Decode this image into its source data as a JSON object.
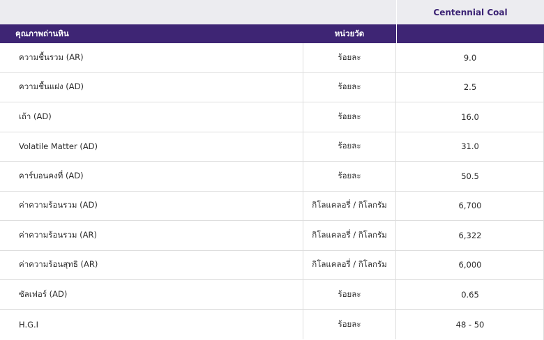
{
  "table": {
    "brand_header": "Centennial Coal",
    "columns": {
      "parameter": "คุณภาพถ่านหิน",
      "unit": "หน่วยวัด"
    },
    "rows": [
      {
        "parameter": "ความชื้นรวม (AR)",
        "unit": "ร้อยละ",
        "value": "9.0"
      },
      {
        "parameter": "ความชื้นแฝง (AD)",
        "unit": "ร้อยละ",
        "value": "2.5"
      },
      {
        "parameter": "เถ้า (AD)",
        "unit": "ร้อยละ",
        "value": "16.0"
      },
      {
        "parameter": "Volatile Matter (AD)",
        "unit": "ร้อยละ",
        "value": "31.0"
      },
      {
        "parameter": "คาร์บอนคงที่ (AD)",
        "unit": "ร้อยละ",
        "value": "50.5"
      },
      {
        "parameter": "ค่าความร้อนรวม (AD)",
        "unit": "กิโลแคลอรี่ / กิโลกรัม",
        "value": "6,700"
      },
      {
        "parameter": "ค่าความร้อนรวม (AR)",
        "unit": "กิโลแคลอรี่ / กิโลกรัม",
        "value": "6,322"
      },
      {
        "parameter": "ค่าความร้อนสุทธิ (AR)",
        "unit": "กิโลแคลอรี่ / กิโลกรัม",
        "value": "6,000"
      },
      {
        "parameter": "ซัลเฟอร์ (AD)",
        "unit": "ร้อยละ",
        "value": "0.65"
      },
      {
        "parameter": "H.G.I",
        "unit": "ร้อยละ",
        "value": "48 - 50"
      }
    ]
  },
  "colors": {
    "header_purple": "#3e2574",
    "brand_text": "#3b2374",
    "top_band": "#ececf0"
  }
}
